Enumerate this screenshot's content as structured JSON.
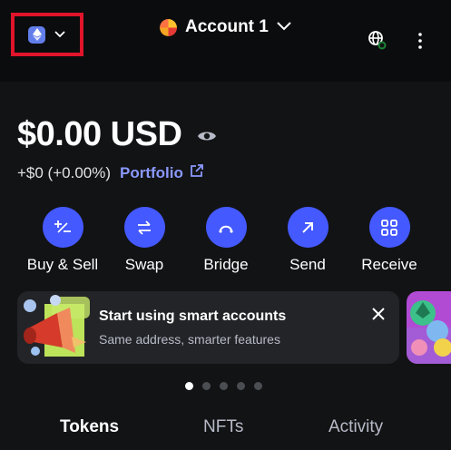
{
  "header": {
    "network_icon": "ethereum-icon",
    "account_name": "Account 1",
    "globe_icon": "globe-connected-icon",
    "menu_icon": "kebab-menu-icon",
    "highlight_color": "#e0142b"
  },
  "balance": {
    "amount": "$0.00 USD",
    "change": "+$0 (+0.00%)",
    "portfolio_label": "Portfolio"
  },
  "actions": [
    {
      "label": "Buy & Sell",
      "icon": "plus-minus-icon"
    },
    {
      "label": "Swap",
      "icon": "swap-arrows-icon"
    },
    {
      "label": "Bridge",
      "icon": "bridge-icon"
    },
    {
      "label": "Send",
      "icon": "arrow-up-right-icon"
    },
    {
      "label": "Receive",
      "icon": "qr-code-icon"
    }
  ],
  "promo_card": {
    "title": "Start using smart accounts",
    "subtitle": "Same address, smarter features"
  },
  "carousel": {
    "total": 5,
    "active": 0
  },
  "tabs": [
    {
      "label": "Tokens",
      "active": true
    },
    {
      "label": "NFTs",
      "active": false
    },
    {
      "label": "Activity",
      "active": false
    }
  ],
  "colors": {
    "accent": "#4459ff",
    "link": "#8b99ff",
    "background": "#121314",
    "header": "#0b0c0d"
  }
}
